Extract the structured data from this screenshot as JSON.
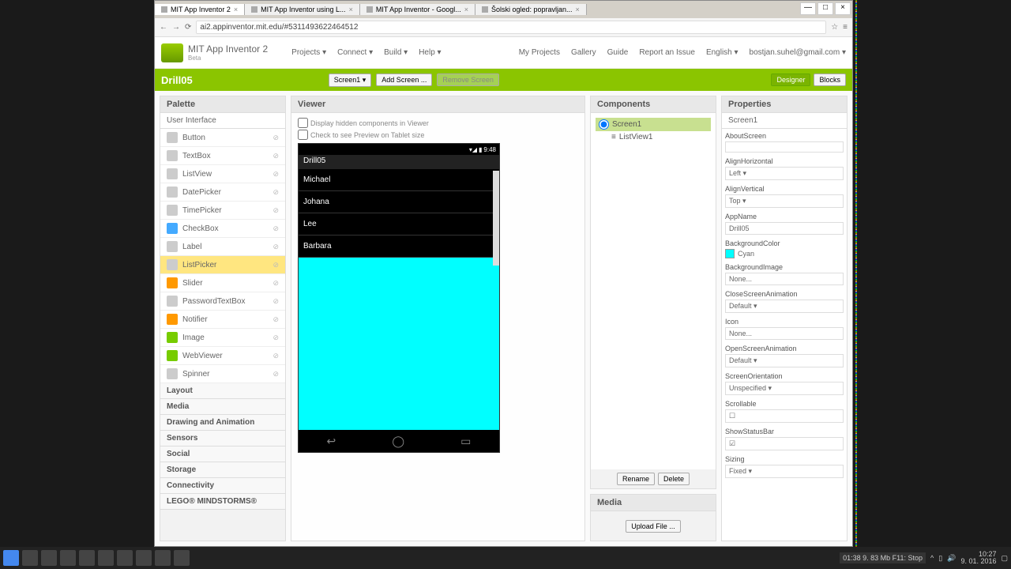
{
  "browser": {
    "tabs": [
      {
        "label": "MIT App Inventor 2",
        "active": true
      },
      {
        "label": "MIT App Inventor using L...",
        "active": false
      },
      {
        "label": "MIT App Inventor - Googl...",
        "active": false
      },
      {
        "label": "Šolski ogled: popravljan...",
        "active": false
      }
    ],
    "url": "ai2.appinventor.mit.edu/#5311493622464512"
  },
  "header": {
    "title": "MIT App Inventor 2",
    "subtitle": "Beta",
    "menu_left": [
      "Projects ▾",
      "Connect ▾",
      "Build ▾",
      "Help ▾"
    ],
    "menu_right": [
      "My Projects",
      "Gallery",
      "Guide",
      "Report an Issue",
      "English ▾",
      "bostjan.suhel@gmail.com ▾"
    ]
  },
  "project_bar": {
    "name": "Drill05",
    "screen_btn": "Screen1 ▾",
    "add_screen": "Add Screen ...",
    "remove_screen": "Remove Screen",
    "designer": "Designer",
    "blocks": "Blocks"
  },
  "palette": {
    "title": "Palette",
    "category": "User Interface",
    "items": [
      "Button",
      "TextBox",
      "ListView",
      "DatePicker",
      "TimePicker",
      "CheckBox",
      "Label",
      "ListPicker",
      "Slider",
      "PasswordTextBox",
      "Notifier",
      "Image",
      "WebViewer",
      "Spinner"
    ],
    "categories": [
      "Layout",
      "Media",
      "Drawing and Animation",
      "Sensors",
      "Social",
      "Storage",
      "Connectivity",
      "LEGO® MINDSTORMS®"
    ]
  },
  "viewer": {
    "title": "Viewer",
    "opt_hidden": "Display hidden components in Viewer",
    "opt_tablet": "Check to see Preview on Tablet size",
    "phone_time": "9:48",
    "app_title": "Drill05",
    "list_items": [
      "Michael",
      "Johana",
      "Lee",
      "Barbara"
    ]
  },
  "components": {
    "title": "Components",
    "root": "Screen1",
    "child": "ListView1",
    "rename": "Rename",
    "delete": "Delete"
  },
  "media": {
    "title": "Media",
    "upload": "Upload File ..."
  },
  "properties": {
    "title": "Properties",
    "target": "Screen1",
    "items": [
      {
        "label": "AboutScreen",
        "val": ""
      },
      {
        "label": "AlignHorizontal",
        "val": "Left ▾"
      },
      {
        "label": "AlignVertical",
        "val": "Top ▾"
      },
      {
        "label": "AppName",
        "val": "Drill05"
      },
      {
        "label": "BackgroundColor",
        "val": "Cyan",
        "color": true
      },
      {
        "label": "BackgroundImage",
        "val": "None..."
      },
      {
        "label": "CloseScreenAnimation",
        "val": "Default ▾"
      },
      {
        "label": "Icon",
        "val": "None..."
      },
      {
        "label": "OpenScreenAnimation",
        "val": "Default ▾"
      },
      {
        "label": "ScreenOrientation",
        "val": "Unspecified ▾"
      },
      {
        "label": "Scrollable",
        "val": "☐"
      },
      {
        "label": "ShowStatusBar",
        "val": "☑"
      },
      {
        "label": "Sizing",
        "val": "Fixed ▾"
      }
    ]
  },
  "taskbar": {
    "time": "10:27",
    "date": "9. 01. 2016",
    "info": "01:38   9. 83 Mb   F11: Stop"
  }
}
